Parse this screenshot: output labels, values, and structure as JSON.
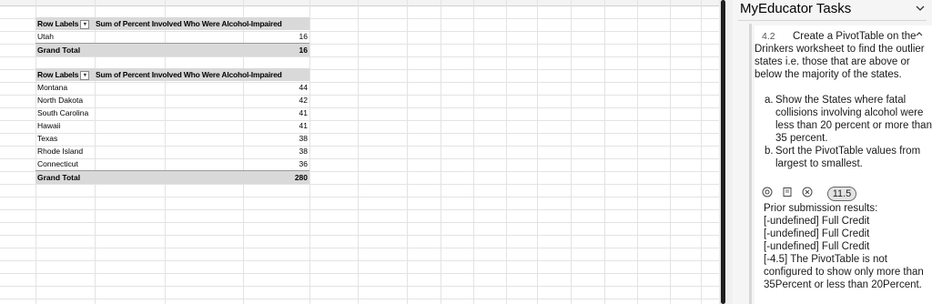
{
  "pivot_top": {
    "header": {
      "row_labels": "Row Labels",
      "values_label": "Sum of Percent Involved Who Were Alcohol-Impaired"
    },
    "rows": [
      {
        "label": "Utah",
        "value": "16"
      }
    ],
    "total": {
      "label": "Grand Total",
      "value": "16"
    }
  },
  "pivot_bottom": {
    "header": {
      "row_labels": "Row Labels",
      "values_label": "Sum of Percent Involved Who Were Alcohol-Impaired"
    },
    "rows": [
      {
        "label": "Montana",
        "value": "44"
      },
      {
        "label": "North Dakota",
        "value": "42"
      },
      {
        "label": "South Carolina",
        "value": "41"
      },
      {
        "label": "Hawaii",
        "value": "41"
      },
      {
        "label": "Texas",
        "value": "38"
      },
      {
        "label": "Rhode Island",
        "value": "38"
      },
      {
        "label": "Connecticut",
        "value": "36"
      }
    ],
    "total": {
      "label": "Grand Total",
      "value": "280"
    }
  },
  "task_pane": {
    "title": "MyEducator Tasks",
    "task_number": "4.2",
    "task_text": "Create a PivotTable on the Drinkers worksheet to find the outlier states i.e. those that are above or below the majority of the states.",
    "subtasks": [
      {
        "letter": "a.",
        "text": "Show the States where fatal collisions involving alcohol were less than 20 percent or more than 35 percent."
      },
      {
        "letter": "b.",
        "text": "Sort the PivotTable values from largest to smallest."
      }
    ],
    "score": "11.5",
    "results_heading": "Prior submission results:",
    "results": [
      "[-undefined] Full Credit",
      "[-undefined] Full Credit",
      "[-undefined] Full Credit",
      "[-4.5] The PivotTable is not configured to show only more than 35Percent or less than 20Percent."
    ]
  }
}
